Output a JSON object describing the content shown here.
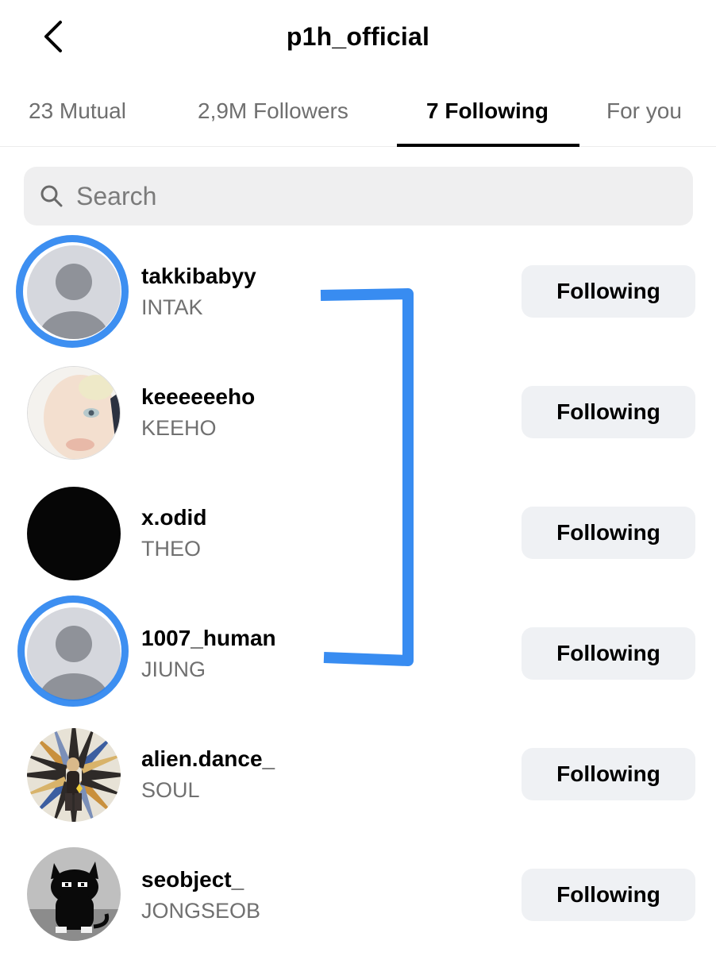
{
  "header": {
    "title": "p1h_official",
    "back_icon": "chevron-left-icon"
  },
  "tabs": [
    {
      "label": "23 Mutual",
      "active": false
    },
    {
      "label": "2,9M Followers",
      "active": false
    },
    {
      "label": "7 Following",
      "active": true
    },
    {
      "label": "For you",
      "active": false
    }
  ],
  "search": {
    "placeholder": "Search",
    "value": "",
    "icon": "search-icon"
  },
  "following": [
    {
      "username": "takkibabyy",
      "name": "INTAK",
      "button": "Following",
      "avatar": "default-avatar-icon",
      "highlighted": true
    },
    {
      "username": "keeeeeeho",
      "name": "KEEHO",
      "button": "Following",
      "avatar": "profile-photo",
      "highlighted": false
    },
    {
      "username": "x.odid",
      "name": "THEO",
      "button": "Following",
      "avatar": "black-profile-photo",
      "highlighted": false
    },
    {
      "username": "1007_human",
      "name": "JIUNG",
      "button": "Following",
      "avatar": "default-avatar-icon",
      "highlighted": true
    },
    {
      "username": "alien.dance_",
      "name": "SOUL",
      "button": "Following",
      "avatar": "psychedelic-profile-photo",
      "highlighted": false
    },
    {
      "username": "seobject_",
      "name": "JONGSEOB",
      "button": "Following",
      "avatar": "black-cat-profile-photo",
      "highlighted": false
    }
  ],
  "colors": {
    "highlight": "#2d86f0",
    "button_bg": "#eff1f4",
    "secondary_text": "#707070"
  }
}
